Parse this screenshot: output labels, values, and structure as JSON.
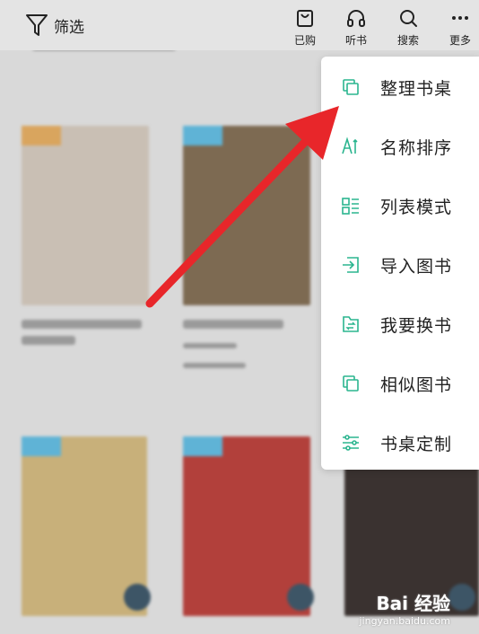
{
  "toolbar": {
    "filter_label": "筛选",
    "purchased_label": "已购",
    "listen_label": "听书",
    "search_label": "搜索",
    "more_label": "更多"
  },
  "menu": {
    "items": [
      {
        "label": "整理书桌",
        "icon": "copy-icon"
      },
      {
        "label": "名称排序",
        "icon": "sort-name-icon"
      },
      {
        "label": "列表模式",
        "icon": "list-mode-icon"
      },
      {
        "label": "导入图书",
        "icon": "import-icon"
      },
      {
        "label": "我要换书",
        "icon": "exchange-book-icon"
      },
      {
        "label": "相似图书",
        "icon": "similar-books-icon"
      },
      {
        "label": "书桌定制",
        "icon": "sliders-icon"
      }
    ]
  },
  "colors": {
    "accent": "#2bb58f",
    "arrow": "#e8262a"
  },
  "watermark": {
    "brand": "Bai 经验",
    "url": "jingyan.baidu.com"
  }
}
